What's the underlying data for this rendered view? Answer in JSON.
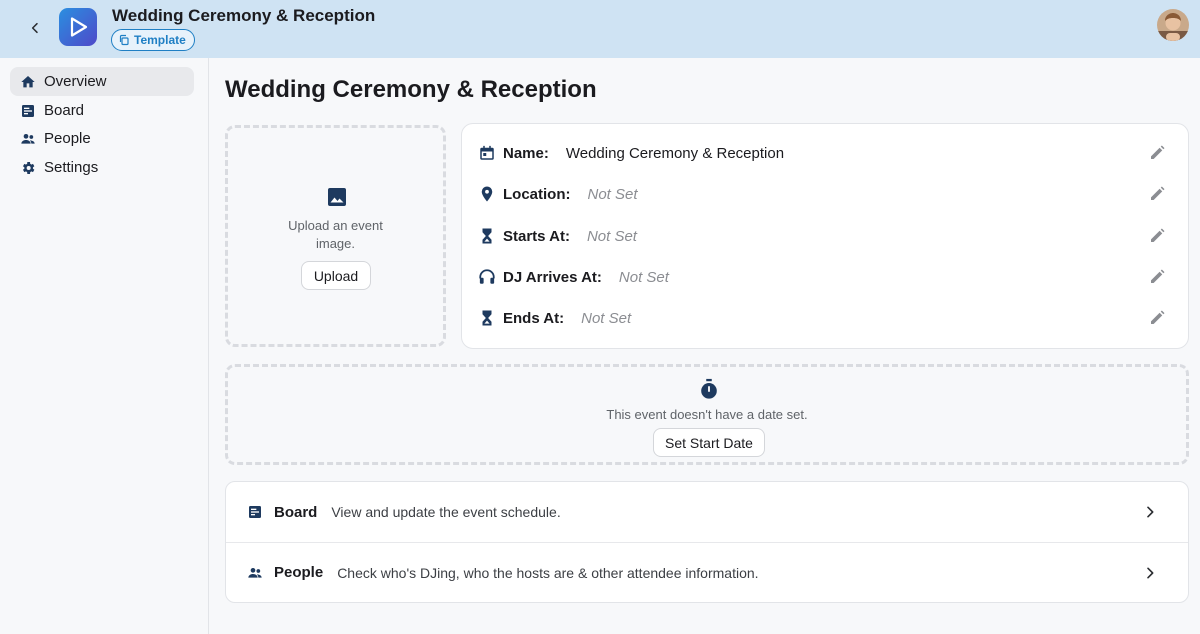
{
  "header": {
    "title": "Wedding Ceremony & Reception",
    "chip_label": "Template",
    "back_icon": "chevron-left-icon",
    "logo_icon": "play-logo-icon"
  },
  "sidebar": {
    "items": [
      {
        "label": "Overview",
        "icon": "home-icon",
        "active": true
      },
      {
        "label": "Board",
        "icon": "board-icon"
      },
      {
        "label": "People",
        "icon": "people-icon"
      },
      {
        "label": "Settings",
        "icon": "gear-icon"
      }
    ]
  },
  "main": {
    "title": "Wedding Ceremony & Reception",
    "upload": {
      "text": "Upload an event image.",
      "button": "Upload"
    },
    "details": [
      {
        "label": "Name:",
        "value": "Wedding Ceremony & Reception",
        "icon": "calendar-icon"
      },
      {
        "label": "Location:",
        "value": "Not Set",
        "icon": "location-pin-icon"
      },
      {
        "label": "Starts At:",
        "value": "Not Set",
        "icon": "hourglass-icon"
      },
      {
        "label": "DJ Arrives At:",
        "value": "Not Set",
        "icon": "headphones-icon"
      },
      {
        "label": "Ends At:",
        "value": "Not Set",
        "icon": "hourglass-icon"
      }
    ],
    "date": {
      "text": "This event doesn't have a date set.",
      "button": "Set Start Date"
    },
    "links": [
      {
        "title": "Board",
        "desc": "View and update the event schedule.",
        "icon": "board-icon"
      },
      {
        "title": "People",
        "desc": "Check who's DJing, who the hosts are & other attendee information.",
        "icon": "people-icon"
      }
    ]
  },
  "colors": {
    "header_bg": "#cfe3f3",
    "accent": "#1f7fc4",
    "icon_navy": "#1e3a5f",
    "muted": "#8b8d92"
  }
}
